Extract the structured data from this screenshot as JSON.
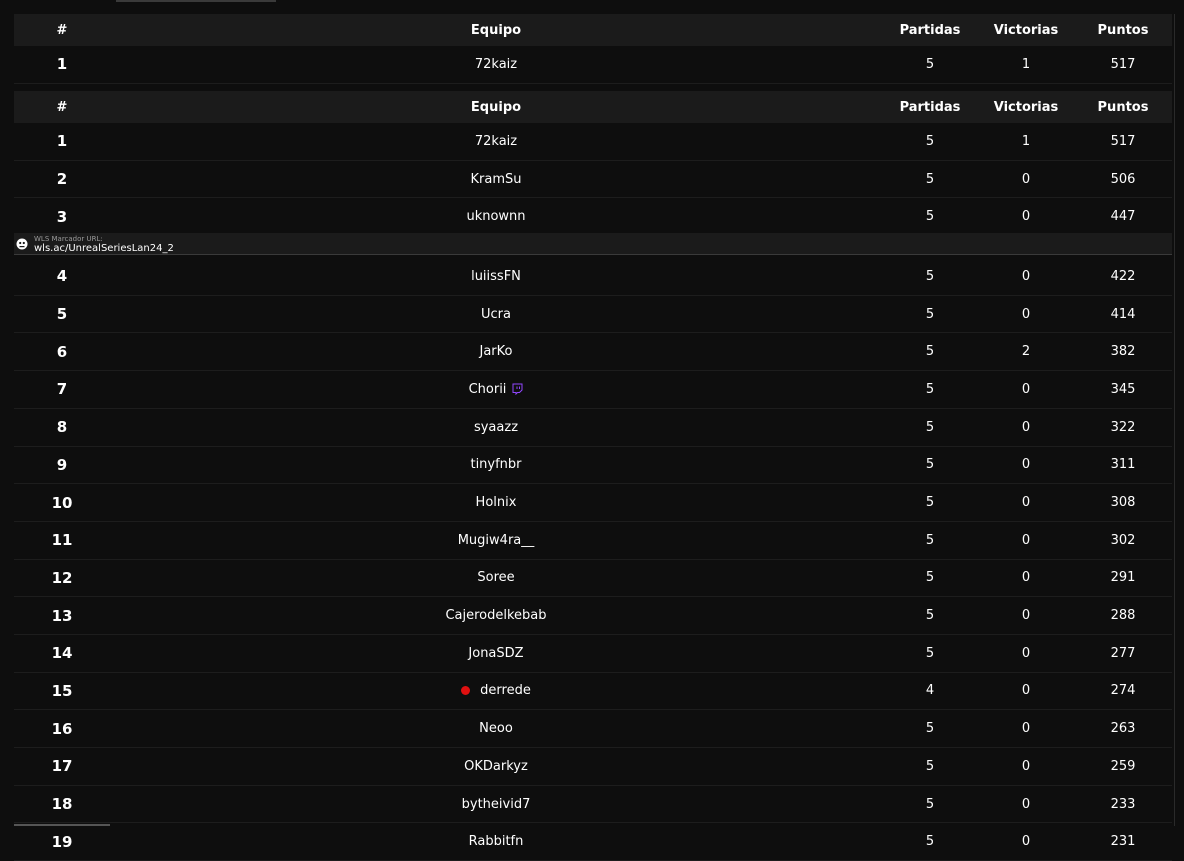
{
  "headers": {
    "rank": "#",
    "team": "Equipo",
    "games": "Partidas",
    "wins": "Victorias",
    "points": "Puntos"
  },
  "pinned_row": {
    "rank": "1",
    "team": "72kaiz",
    "games": "5",
    "wins": "1",
    "points": "517"
  },
  "rows": [
    {
      "rank": "1",
      "team": "72kaiz",
      "games": "5",
      "wins": "1",
      "points": "517"
    },
    {
      "rank": "2",
      "team": "KramSu",
      "games": "5",
      "wins": "0",
      "points": "506"
    },
    {
      "rank": "3",
      "team": "uknownn",
      "games": "5",
      "wins": "0",
      "points": "447"
    },
    {
      "rank": "4",
      "team": "luiissFN",
      "games": "5",
      "wins": "0",
      "points": "422"
    },
    {
      "rank": "5",
      "team": "Ucra",
      "games": "5",
      "wins": "0",
      "points": "414"
    },
    {
      "rank": "6",
      "team": "JarKo",
      "games": "5",
      "wins": "2",
      "points": "382"
    },
    {
      "rank": "7",
      "team": "Chorii",
      "games": "5",
      "wins": "0",
      "points": "345",
      "icon": "twitch-icon"
    },
    {
      "rank": "8",
      "team": "syaazz",
      "games": "5",
      "wins": "0",
      "points": "322"
    },
    {
      "rank": "9",
      "team": "tinyfnbr",
      "games": "5",
      "wins": "0",
      "points": "311"
    },
    {
      "rank": "10",
      "team": "Holnix",
      "games": "5",
      "wins": "0",
      "points": "308"
    },
    {
      "rank": "11",
      "team": "Mugiw4ra__",
      "games": "5",
      "wins": "0",
      "points": "302"
    },
    {
      "rank": "12",
      "team": "Soree",
      "games": "5",
      "wins": "0",
      "points": "291"
    },
    {
      "rank": "13",
      "team": "Cajerodelkebab",
      "games": "5",
      "wins": "0",
      "points": "288"
    },
    {
      "rank": "14",
      "team": "JonaSDZ",
      "games": "5",
      "wins": "0",
      "points": "277"
    },
    {
      "rank": "15",
      "team": "derrede",
      "games": "4",
      "wins": "0",
      "points": "274",
      "icon": "live-dot-icon"
    },
    {
      "rank": "16",
      "team": "Neoo",
      "games": "5",
      "wins": "0",
      "points": "263"
    },
    {
      "rank": "17",
      "team": "OKDarkyz",
      "games": "5",
      "wins": "0",
      "points": "259"
    },
    {
      "rank": "18",
      "team": "bytheivid7",
      "games": "5",
      "wins": "0",
      "points": "233"
    },
    {
      "rank": "19",
      "team": "Rabbitfn",
      "games": "5",
      "wins": "0",
      "points": "231"
    }
  ],
  "banner": {
    "label": "WLS Marcador URL:",
    "url": "wls.ac/UnrealSeriesLan24_2"
  },
  "colors": {
    "background": "#0e0e0e",
    "header_bg": "#1b1b1b",
    "twitch": "#9146ff",
    "live": "#e01010"
  }
}
